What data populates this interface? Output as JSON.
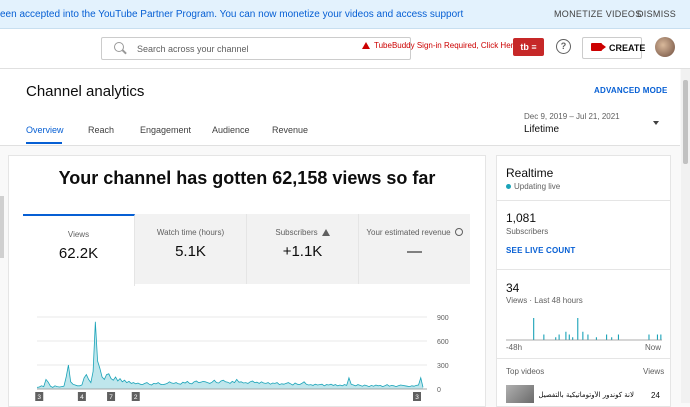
{
  "banner": {
    "message": "een accepted into the YouTube Partner Program. You can now monetize your videos and access support",
    "monetize_label": "MONETIZE VIDEOS",
    "dismiss_label": "DISMISS"
  },
  "topbar": {
    "search_placeholder": "Search across your channel",
    "tubebuddy_warning": "TubeBuddy Sign-in Required, Click Here",
    "tubebuddy_button": "tb ≡",
    "help_glyph": "?",
    "create_label": "CREATE"
  },
  "header": {
    "title": "Channel analytics",
    "advanced_mode": "ADVANCED MODE",
    "tabs": [
      {
        "label": "Overview",
        "active": true
      },
      {
        "label": "Reach",
        "active": false
      },
      {
        "label": "Engagement",
        "active": false
      },
      {
        "label": "Audience",
        "active": false
      },
      {
        "label": "Revenue",
        "active": false
      }
    ],
    "date_range": "Dec 9, 2019 – Jul 21, 2021",
    "date_range_value": "Lifetime"
  },
  "overview": {
    "headline": "Your channel has gotten 62,158 views so far",
    "metrics": [
      {
        "label": "Views",
        "value": "62.2K"
      },
      {
        "label": "Watch time (hours)",
        "value": "5.1K"
      },
      {
        "label": "Subscribers",
        "value": "+1.1K"
      },
      {
        "label": "Your estimated revenue",
        "value": "—"
      }
    ]
  },
  "chart_data": {
    "type": "area",
    "series": [
      {
        "values": [
          20,
          25,
          40,
          30,
          120,
          85,
          35,
          20,
          40,
          30,
          25,
          30,
          35,
          150,
          300,
          90,
          60,
          50,
          40,
          40,
          50,
          140,
          180,
          120,
          80,
          220,
          840,
          350,
          260,
          150,
          120,
          180,
          190,
          130,
          110,
          150,
          100,
          130,
          90,
          110,
          80,
          95,
          70,
          80,
          65,
          75,
          60,
          55,
          70,
          80,
          60,
          50,
          70,
          65,
          80,
          60,
          55,
          60,
          70,
          90,
          75,
          70,
          80,
          65,
          60,
          85,
          75,
          95,
          70,
          65,
          90,
          100,
          80,
          85,
          95,
          90,
          80,
          70,
          85,
          110,
          80,
          75,
          100,
          110,
          90,
          85,
          70,
          95,
          80,
          120,
          85,
          90,
          75,
          80,
          70,
          90,
          100,
          80,
          85,
          70,
          90,
          75,
          70,
          80,
          60,
          75,
          70,
          80,
          55,
          65,
          60,
          70,
          80,
          65,
          50,
          75,
          60,
          55,
          70,
          90,
          60,
          50,
          55,
          45,
          60,
          50,
          55,
          60,
          40,
          55,
          50,
          60,
          45,
          55,
          40,
          50,
          40,
          55,
          45,
          140,
          60,
          50,
          40,
          55,
          45,
          35,
          50,
          40,
          30,
          45,
          35,
          50,
          40,
          45,
          30,
          40,
          55,
          35,
          45,
          40,
          30,
          40,
          50,
          45,
          40,
          35,
          30,
          40,
          35,
          45,
          50,
          140,
          20
        ]
      }
    ],
    "y_ticks": [
      "900",
      "600",
      "300",
      "0"
    ],
    "ylim": [
      0,
      900
    ],
    "grid": true,
    "annotations": [
      {
        "label": "3",
        "index": 1
      },
      {
        "label": "4",
        "index": 20
      },
      {
        "label": "7",
        "index": 33
      },
      {
        "label": "2",
        "index": 44
      },
      {
        "label": "3",
        "index": 230
      }
    ]
  },
  "realtime": {
    "title": "Realtime",
    "status": "Updating live",
    "subscribers": "1,081",
    "subscribers_label": "Subscribers",
    "live_count_link": "SEE LIVE COUNT",
    "views": "34",
    "views_label": "Views · Last 48 hours",
    "left_label": "-48h",
    "right_label": "Now",
    "mini_values": [
      0,
      0,
      0,
      0,
      0,
      0,
      0,
      0,
      0,
      0,
      0,
      0,
      0,
      0,
      0,
      0,
      8,
      0,
      0,
      0,
      0,
      0,
      2,
      0,
      0,
      0,
      0,
      0,
      0,
      1,
      0,
      2,
      0,
      0,
      0,
      3,
      0,
      2,
      0,
      1,
      0,
      0,
      8,
      0,
      0,
      3,
      0,
      0,
      2,
      0,
      0,
      0,
      0,
      1,
      0,
      0,
      0,
      0,
      0,
      2,
      0,
      0,
      1,
      0,
      0,
      0,
      2,
      0,
      0,
      0,
      0,
      0,
      0,
      0,
      0,
      0,
      0,
      0,
      0,
      0,
      0,
      0,
      0,
      0,
      2,
      0,
      0,
      0,
      0,
      2,
      0,
      2
    ],
    "top_videos_label": "Top videos",
    "views_header": "Views",
    "top_video_title": "لانة كوندور الأوتوماتيكية بالتفصيل",
    "top_video_views": "24"
  },
  "colors": {
    "accent": "#065fd4",
    "chart_line": "#1aa3b8",
    "chart_fill": "#bfe6ec",
    "banner_bg": "#e3f2fd",
    "warning": "#cc0000"
  }
}
